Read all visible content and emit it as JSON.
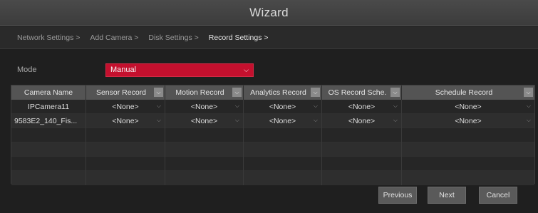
{
  "window": {
    "title": "Wizard"
  },
  "steps": [
    {
      "label": "Network Settings >",
      "active": false
    },
    {
      "label": "Add Camera >",
      "active": false
    },
    {
      "label": "Disk Settings >",
      "active": false
    },
    {
      "label": "Record Settings >",
      "active": true
    }
  ],
  "mode": {
    "label": "Mode",
    "value": "Manual"
  },
  "table": {
    "columns": [
      "Camera Name",
      "Sensor Record",
      "Motion Record",
      "Analytics Record",
      "OS Record Sche.",
      "Schedule Record"
    ],
    "rows": [
      [
        "IPCamera11",
        "<None>",
        "<None>",
        "<None>",
        "<None>",
        "<None>"
      ],
      [
        "9583E2_140_Fis...",
        "<None>",
        "<None>",
        "<None>",
        "<None>",
        "<None>"
      ]
    ]
  },
  "buttons": {
    "previous": "Previous",
    "next": "Next",
    "cancel": "Cancel"
  },
  "colors": {
    "accent": "#c4102e",
    "header": "#545454",
    "background": "#1f1f1f"
  }
}
